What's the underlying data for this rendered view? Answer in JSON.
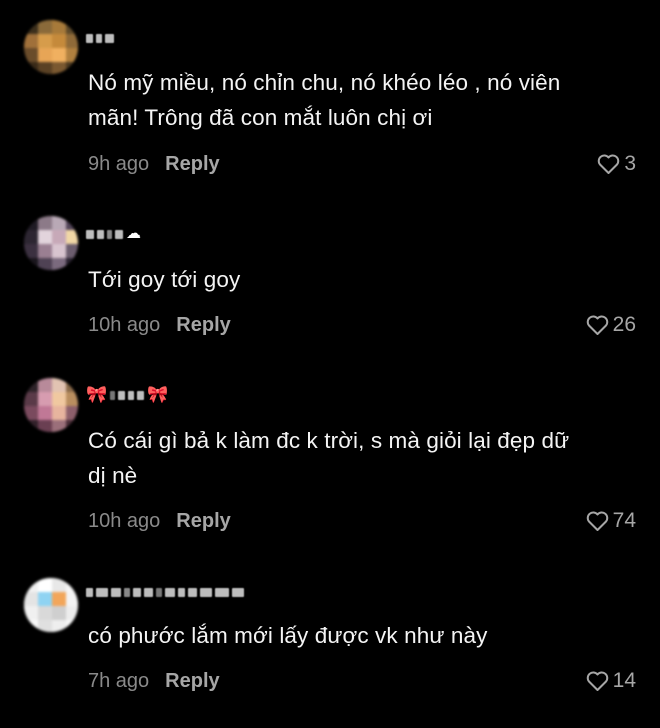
{
  "comments": [
    {
      "text_line1": "Nó mỹ miều, nó chỉn chu, nó khéo léo , nó viên",
      "text_line2": "mãn! Trông đã con mắt luôn chị ơi",
      "time": "9h ago",
      "reply_label": "Reply",
      "likes": "3",
      "like_icon": "heart-outline-icon"
    },
    {
      "text_line1": "Tới goy tới goy",
      "time": "10h ago",
      "reply_label": "Reply",
      "likes": "26",
      "like_icon": "heart-outline-icon"
    },
    {
      "text_line1": "Có cái gì bả k làm đc k trời, s mà giỏi lại đẹp dữ",
      "text_line2": "dị nè",
      "time": "10h ago",
      "reply_label": "Reply",
      "likes": "74",
      "like_icon": "heart-outline-icon"
    },
    {
      "text_line1": "có phước lắm mới lấy được vk như này",
      "time": "7h ago",
      "reply_label": "Reply",
      "likes": "14",
      "like_icon": "heart-outline-icon"
    }
  ],
  "colors": {
    "background": "#000000",
    "text": "#f4f4f4",
    "meta": "#8a8a8a",
    "reply": "#a6a6a6"
  }
}
